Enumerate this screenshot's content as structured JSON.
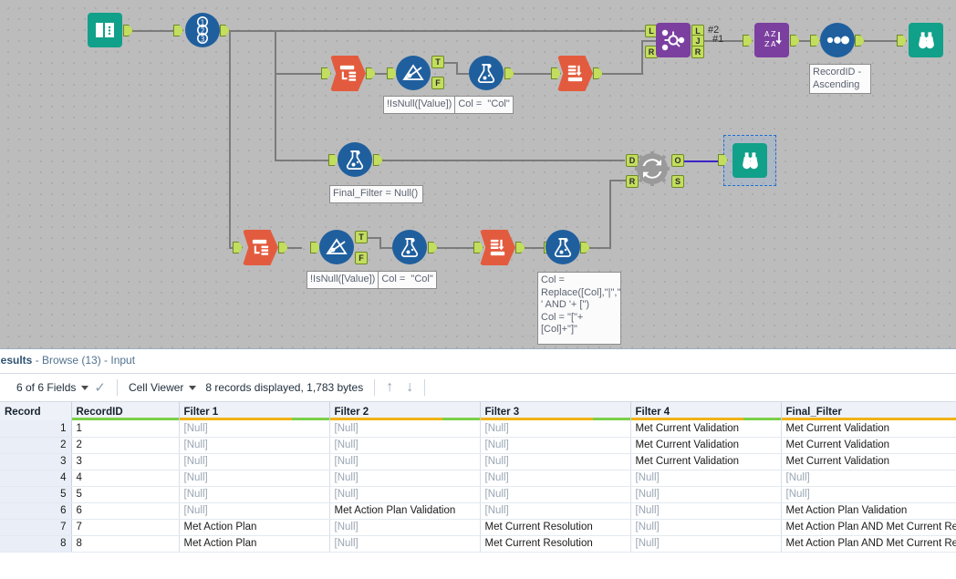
{
  "canvas": {
    "tools": [
      {
        "name": "input-data-tool",
        "icon": "book-icon",
        "label": "Input Data"
      },
      {
        "name": "record-id-tool",
        "icon": "record-id-icon",
        "label": "Record ID"
      },
      {
        "name": "transpose-tool-top",
        "icon": "transpose-icon",
        "label": "Transpose"
      },
      {
        "name": "filter-tool-top",
        "icon": "filter-funnel-icon",
        "label": "Filter"
      },
      {
        "name": "formula-tool-top",
        "icon": "flask-icon",
        "label": "Formula"
      },
      {
        "name": "crosstab-tool-top",
        "icon": "crosstab-icon",
        "label": "Cross Tab"
      },
      {
        "name": "join-tool",
        "icon": "join-icon",
        "label": "Join"
      },
      {
        "name": "sort-tool",
        "icon": "sort-icon",
        "label": "Sort"
      },
      {
        "name": "summarize-tool",
        "icon": "summarize-icon",
        "label": "Summarize"
      },
      {
        "name": "browse-tool-top",
        "icon": "binoculars-icon",
        "label": "Browse"
      },
      {
        "name": "formula-tool-middle",
        "icon": "flask-icon",
        "label": "Formula"
      },
      {
        "name": "dynamic-rename-tool",
        "icon": "refresh-gear-icon",
        "label": "Dynamic Rename"
      },
      {
        "name": "browse-tool-selected",
        "icon": "binoculars-icon",
        "label": "Browse"
      },
      {
        "name": "transpose-tool-bottom",
        "icon": "transpose-icon",
        "label": "Transpose"
      },
      {
        "name": "filter-tool-bottom",
        "icon": "filter-funnel-icon",
        "label": "Filter"
      },
      {
        "name": "formula-tool-bottom",
        "icon": "flask-icon",
        "label": "Formula"
      },
      {
        "name": "crosstab-tool-bottom",
        "icon": "crosstab-icon",
        "label": "Cross Tab"
      },
      {
        "name": "formula-tool-bottom-right",
        "icon": "flask-icon",
        "label": "Formula"
      }
    ],
    "annotations": {
      "filter_top": "!IsNull([Value])",
      "formula_top": "Col =  \"Col\"",
      "formula_middle": "Final_Filter = Null()",
      "sort_label": "RecordID - Ascending",
      "filter_bottom": "!IsNull([Value])",
      "formula_bottom": "Col =  \"Col\"",
      "formula_bottom_right": "Col = Replace([Col],\"|\",'')+ ' AND '+ [\")\nCol = \"[\"+[Col]+\"]\""
    },
    "connection_labels": {
      "union_2": "#2",
      "union_1": "#1"
    },
    "port_labels": {
      "join_left": "L",
      "join_right": "R",
      "join_out_left": "L",
      "join_out_join": "J",
      "join_out_right": "R",
      "filter_true": "T",
      "filter_false": "F",
      "rename_data": "D",
      "rename_rename": "R",
      "rename_out": "O",
      "rename_skipped": "S"
    },
    "colors": {
      "canvas_bg": "#bcbcbc",
      "teal_tool": "#11a08a",
      "blue_tool": "#1f5f9e",
      "red_tool": "#e35b3e",
      "purple_tool": "#7b3fa0",
      "gray_tool": "#9a9a9a",
      "anchor_green": "#c3dd5e",
      "selection_blue": "#1d6fd0"
    }
  },
  "results": {
    "title_bold": "Results",
    "title_rest": " - Browse (13) - Input",
    "toolbar": {
      "fields": "6 of 6 Fields",
      "viewer": "Cell Viewer",
      "records": "8 records displayed, 1,783 bytes",
      "check_icon": "check-icon",
      "up_icon": "arrow-up-icon",
      "down_icon": "arrow-down-icon"
    },
    "grid": {
      "columns": [
        {
          "label": "Record",
          "bar": []
        },
        {
          "label": "RecordID",
          "bar": [
            "#7bd04a"
          ]
        },
        {
          "label": "Filter 1",
          "bar": [
            "#f0b216",
            "#7bd04a"
          ]
        },
        {
          "label": "Filter 2",
          "bar": [
            "#f0b216",
            "#7bd04a"
          ]
        },
        {
          "label": "Filter 3",
          "bar": [
            "#f0b216",
            "#7bd04a"
          ]
        },
        {
          "label": "Filter 4",
          "bar": [
            "#f0b216",
            "#7bd04a"
          ]
        },
        {
          "label": "Final_Filter",
          "bar": [
            "#f0b216",
            "#7bd04a"
          ]
        }
      ],
      "rows": [
        [
          "1",
          "1",
          "[Null]",
          "[Null]",
          "[Null]",
          "Met Current Validation",
          "Met Current Validation"
        ],
        [
          "2",
          "2",
          "[Null]",
          "[Null]",
          "[Null]",
          "Met Current Validation",
          "Met Current Validation"
        ],
        [
          "3",
          "3",
          "[Null]",
          "[Null]",
          "[Null]",
          "Met Current Validation",
          "Met Current Validation"
        ],
        [
          "4",
          "4",
          "[Null]",
          "[Null]",
          "[Null]",
          "[Null]",
          "[Null]"
        ],
        [
          "5",
          "5",
          "[Null]",
          "[Null]",
          "[Null]",
          "[Null]",
          "[Null]"
        ],
        [
          "6",
          "6",
          "[Null]",
          "Met Action Plan Validation",
          "[Null]",
          "[Null]",
          "Met Action Plan Validation"
        ],
        [
          "7",
          "7",
          "Met Action Plan",
          "[Null]",
          "Met Current Resolution",
          "[Null]",
          "Met Action Plan AND Met Current Resolution"
        ],
        [
          "8",
          "8",
          "Met Action Plan",
          "[Null]",
          "Met Current Resolution",
          "[Null]",
          "Met Action Plan AND Met Current Resolution"
        ]
      ]
    }
  }
}
